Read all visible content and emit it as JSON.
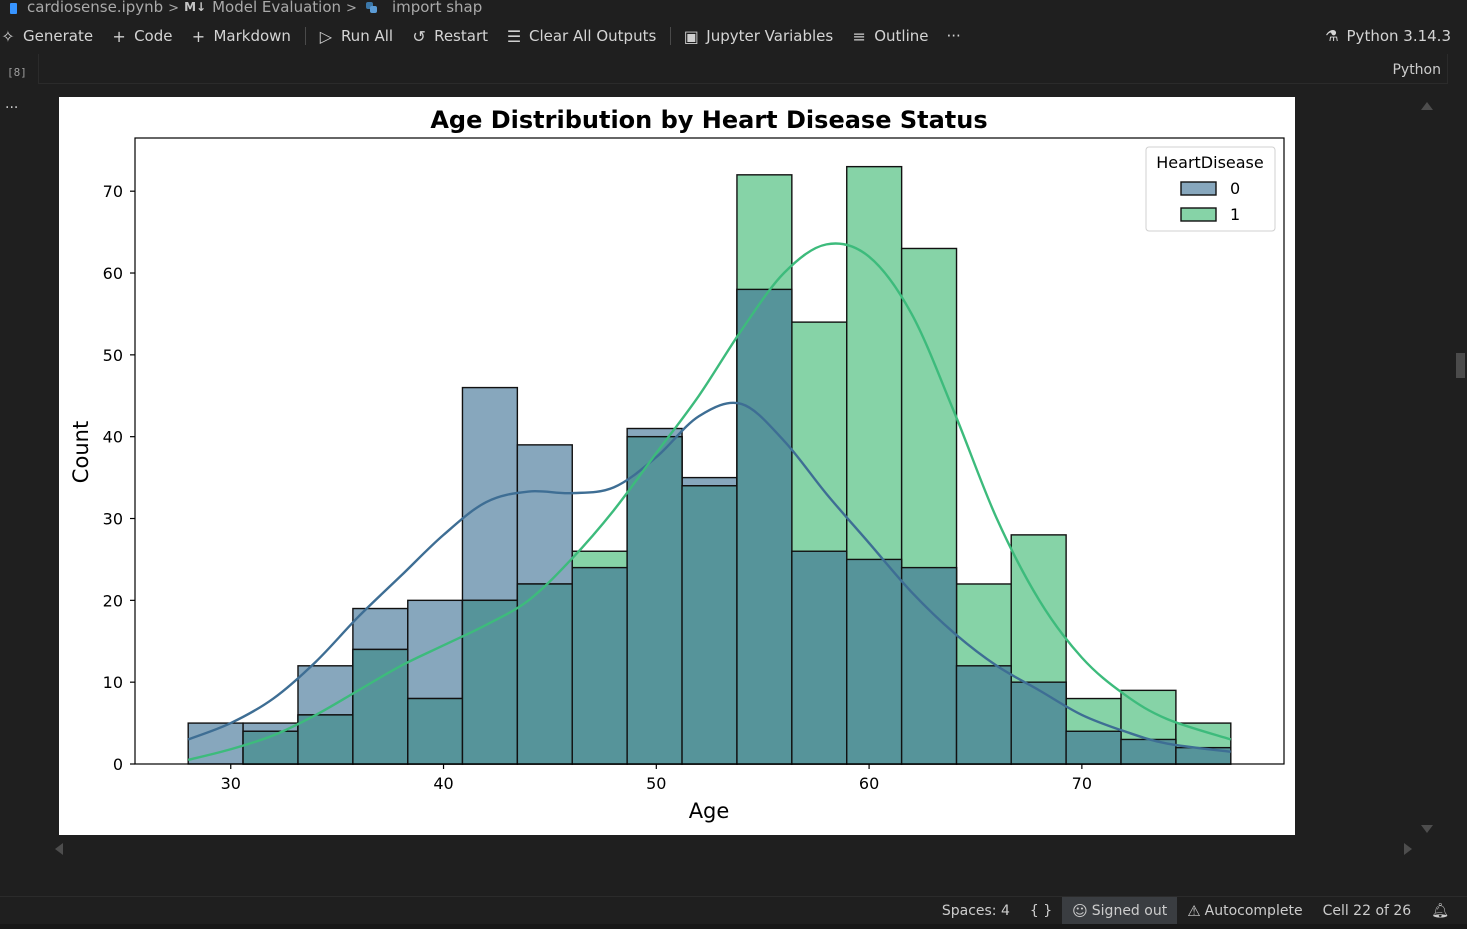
{
  "breadcrumb": {
    "file": "cardiosense.ipynb",
    "section": "Model Evaluation",
    "cell": "import shap",
    "markdown_icon": "M↓"
  },
  "toolbar": {
    "generate": "Generate",
    "code": "Code",
    "markdown": "Markdown",
    "run_all": "Run All",
    "restart": "Restart",
    "clear_all": "Clear All Outputs",
    "variables": "Jupyter Variables",
    "outline": "Outline",
    "more": "···",
    "kernel": "Python 3.14.3"
  },
  "cell": {
    "execution_count": "[8]",
    "language": "Python",
    "more": "..."
  },
  "status": {
    "spaces": "Spaces: 4",
    "braces": "{ }",
    "signed_out": "Signed out",
    "autocomplete": "Autocomplete",
    "cell_position": "Cell 22 of 26"
  },
  "colors": {
    "series0_fill": "#87a7bd",
    "series0_line": "#3e6e94",
    "series1_fill": "#86d3a7",
    "series1_line": "#3dbb7c",
    "overlap_fill": "#56949a"
  },
  "chart_data": {
    "type": "bar",
    "title": "Age Distribution by Heart Disease Status",
    "xlabel": "Age",
    "ylabel": "Count",
    "xlim": [
      25.5,
      79.5
    ],
    "ylim": [
      0,
      76.5
    ],
    "xticks": [
      30,
      40,
      50,
      60,
      70
    ],
    "yticks": [
      0,
      10,
      20,
      30,
      40,
      50,
      60,
      70
    ],
    "bin_edges": [
      28,
      30.58,
      33.16,
      35.74,
      38.32,
      40.89,
      43.47,
      46.05,
      48.63,
      51.21,
      53.79,
      56.37,
      58.95,
      61.53,
      64.11,
      66.68,
      69.26,
      71.84,
      74.42,
      77
    ],
    "legend": {
      "title": "HeartDisease",
      "position": "top-right"
    },
    "grid": false,
    "series": [
      {
        "name": "0",
        "values": [
          5,
          5,
          12,
          19,
          20,
          46,
          39,
          24,
          41,
          35,
          58,
          26,
          25,
          24,
          12,
          10,
          4,
          3,
          2
        ]
      },
      {
        "name": "1",
        "values": [
          0,
          4,
          6,
          14,
          8,
          20,
          22,
          26,
          40,
          34,
          72,
          54,
          73,
          63,
          22,
          28,
          8,
          9,
          5
        ]
      }
    ],
    "kde": [
      {
        "name": "0",
        "x": [
          28,
          30,
          32,
          34,
          36,
          38,
          40,
          42,
          44,
          46,
          48,
          50,
          52,
          54,
          56,
          58,
          60,
          62,
          64,
          66,
          68,
          70,
          72,
          74,
          77
        ],
        "y": [
          3,
          5,
          8,
          12.5,
          18,
          23,
          28,
          32,
          33.3,
          33.1,
          33.8,
          37.5,
          42.5,
          44,
          39.5,
          33,
          27,
          21,
          16,
          12,
          9,
          6,
          4,
          2.5,
          1.5
        ]
      },
      {
        "name": "1",
        "x": [
          28,
          30,
          32,
          34,
          36,
          38,
          40,
          42,
          44,
          46,
          48,
          50,
          52,
          54,
          56,
          58,
          60,
          62,
          64,
          66,
          68,
          70,
          72,
          74,
          77
        ],
        "y": [
          0.5,
          1.8,
          3.5,
          6,
          9,
          12,
          14.5,
          17,
          20,
          25,
          31,
          38,
          45,
          53,
          60,
          63.5,
          62,
          55,
          43,
          30,
          20,
          13,
          8.5,
          5.5,
          3
        ]
      }
    ]
  }
}
